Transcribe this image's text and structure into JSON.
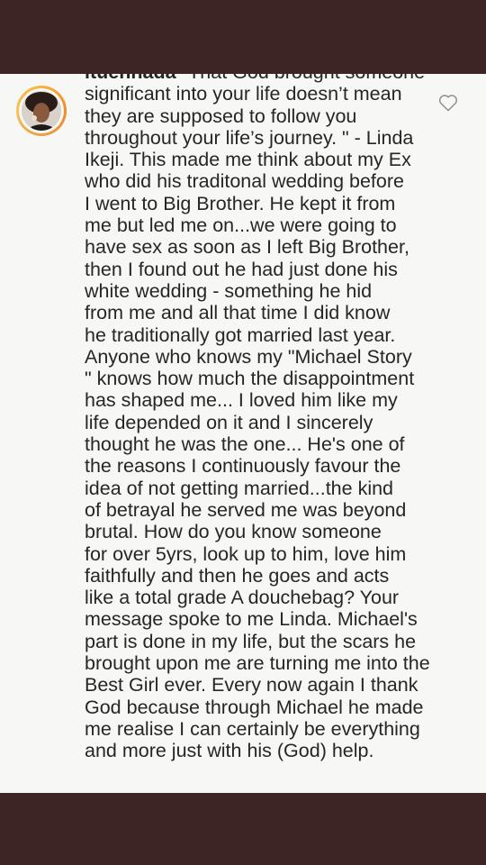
{
  "comment": {
    "username": "ituennada",
    "first_line_rest": " \"That God brought someone",
    "lines": [
      "significant into your life doesn’t mean",
      "they are supposed to follow you",
      "throughout your life’s journey. \" - Linda",
      "Ikeji. This made me think about my Ex",
      "who did his traditonal wedding before",
      "I went to Big Brother. He kept it from",
      "me but led me on...we were going to",
      "have sex as soon as I left Big Brother,",
      "then I found out he had just done his",
      "white wedding - something he hid",
      "from me and all that time I did know",
      "he traditionally got married last year.",
      "Anyone who knows my \"Michael Story",
      "\" knows how much the disappointment",
      "has shaped me... I loved him like my",
      "life depended on it and I sincerely",
      "thought he was the one... He's one of",
      "the reasons I continuously favour the",
      "idea of not getting married...the kind",
      "of betrayal he served me was beyond",
      "brutal. How do you know someone",
      "for over 5yrs, look up to him, love him",
      "faithfully and then he goes and acts",
      "like a total grade A douchebag? Your",
      "message spoke to me Linda. Michael's",
      "part is done in my life, but the scars he",
      "brought upon me are turning me into the",
      "Best Girl ever. Every now again I thank",
      "God because through Michael he made",
      "me realise I can certainly be everything",
      "and more just with his (God) help."
    ]
  },
  "icons": {
    "like": "heart-outline-icon",
    "avatar": "profile-avatar"
  },
  "colors": {
    "background_band": "#3d2523",
    "card": "#f7f7f5",
    "text": "#262626",
    "story_ring": "#f5b53d"
  }
}
